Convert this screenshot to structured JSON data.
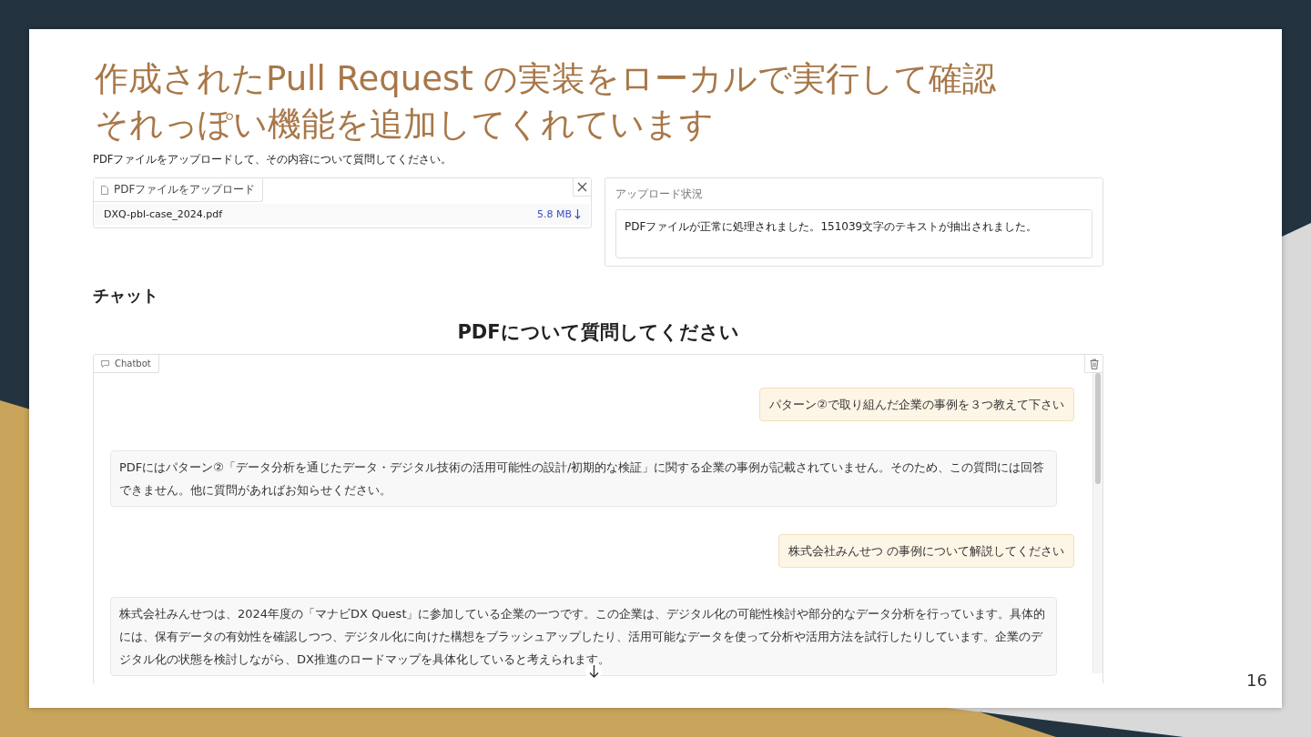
{
  "slide": {
    "title_lines": [
      "作成されたPull Request の実装をローカルで実行して確認",
      "それっぽい機能を追加してくれています"
    ],
    "page_number": "16"
  },
  "app": {
    "description": "PDFファイルをアップロードして、その内容について質問してください。",
    "upload": {
      "label": "PDFファイルをアップロード",
      "file_name": "DXQ-pbl-case_2024.pdf",
      "file_size": "5.8 MB"
    },
    "status": {
      "label": "アップロード状況",
      "value": "PDFファイルが正常に処理されました。151039文字のテキストが抽出されました。"
    },
    "chat_heading": "チャット",
    "chat_title": "PDFについて質問してください",
    "chatbot": {
      "label": "Chatbot",
      "messages": [
        {
          "kind": "user",
          "text": "パターン②で取り組んだ企業の事例を３つ教えて下さい"
        },
        {
          "kind": "bot",
          "text": "PDFにはパターン②「データ分析を通じたデータ・デジタル技術の活用可能性の設計/初期的な検証」に関する企業の事例が記載されていません。そのため、この質問には回答できません。他に質問があればお知らせください。"
        },
        {
          "kind": "user",
          "text": "株式会社みんせつ の事例について解説してください"
        },
        {
          "kind": "bot",
          "text": "株式会社みんせつは、2024年度の「マナビDX Quest」に参加している企業の一つです。この企業は、デジタル化の可能性検討や部分的なデータ分析を行っています。具体的には、保有データの有効性を確認しつつ、デジタル化に向けた構想をブラッシュアップしたり、活用可能なデータを使って分析や活用方法を試行したりしています。企業のデジタル化の状態を検討しながら、DX推進のロードマップを具体化していると考えられます。"
        }
      ]
    }
  }
}
